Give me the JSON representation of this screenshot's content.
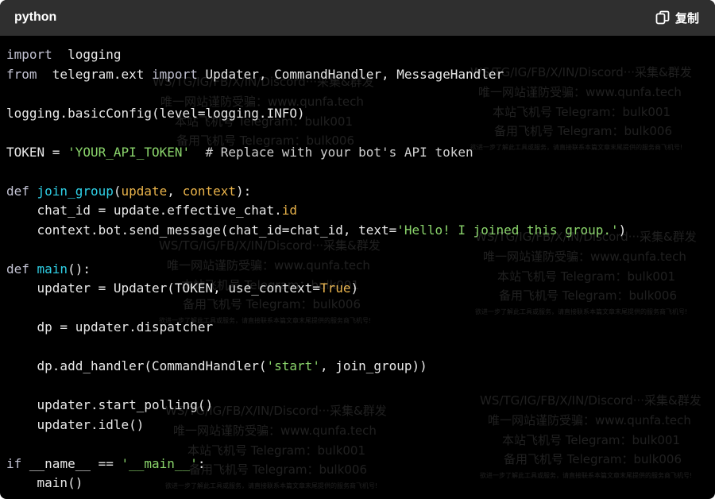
{
  "header": {
    "language": "python",
    "copy_label": "复制",
    "copy_icon": "copy-icon"
  },
  "code_lines": [
    [
      [
        "kw",
        "import"
      ],
      [
        "",
        "  logging"
      ]
    ],
    [
      [
        "kw",
        "from"
      ],
      [
        "",
        "  telegram.ext "
      ],
      [
        "kw",
        "import"
      ],
      [
        "",
        " Updater, CommandHandler, MessageHandler"
      ]
    ],
    [],
    [
      [
        "",
        "logging.basicConfig(level=logging.INFO)"
      ]
    ],
    [],
    [
      [
        "",
        "TOKEN = "
      ],
      [
        "st",
        "'YOUR_API_TOKEN'"
      ],
      [
        "cm",
        "  # Replace with your bot's API token"
      ]
    ],
    [],
    [
      [
        "kw",
        "def "
      ],
      [
        "fn",
        "join_group"
      ],
      [
        "",
        "("
      ],
      [
        "pa",
        "update"
      ],
      [
        "",
        ", "
      ],
      [
        "pa",
        "context"
      ],
      [
        "",
        "):"
      ]
    ],
    [
      [
        "",
        "    chat_id = update.effective_chat."
      ],
      [
        "bi",
        "id"
      ]
    ],
    [
      [
        "",
        "    context.bot.send_message(chat_id=chat_id, text="
      ],
      [
        "st",
        "'Hello! I joined this group.'"
      ],
      [
        "",
        ")"
      ]
    ],
    [],
    [
      [
        "kw",
        "def "
      ],
      [
        "fn",
        "main"
      ],
      [
        "",
        "():"
      ]
    ],
    [
      [
        "",
        "    updater = Updater(TOKEN, use_context="
      ],
      [
        "bi",
        "True"
      ],
      [
        "",
        ")"
      ]
    ],
    [],
    [
      [
        "",
        "    dp = updater.dispatcher"
      ]
    ],
    [],
    [
      [
        "",
        "    dp.add_handler(CommandHandler("
      ],
      [
        "st",
        "'start'"
      ],
      [
        "",
        ", join_group))"
      ]
    ],
    [],
    [
      [
        "",
        "    updater.start_polling()"
      ]
    ],
    [
      [
        "",
        "    updater.idle()"
      ]
    ],
    [],
    [
      [
        "kw",
        "if "
      ],
      [
        "",
        "__name__ == "
      ],
      [
        "st",
        "'__main__'"
      ],
      [
        "",
        ":"
      ]
    ],
    [
      [
        "",
        "    main()"
      ]
    ]
  ],
  "watermark": {
    "line1": "WS/TG/IG/FB/X/IN/Discord···采集&群发",
    "line2": "唯一网站谨防受骗：www.qunfa.tech",
    "line3": "本站飞机号 Telegram：bulk001",
    "line4": "备用飞机号 Telegram：bulk006",
    "line5": "欲进一步了解此工具或服务，请直接联系本篇文章末尾提供的服务商飞机号!"
  }
}
